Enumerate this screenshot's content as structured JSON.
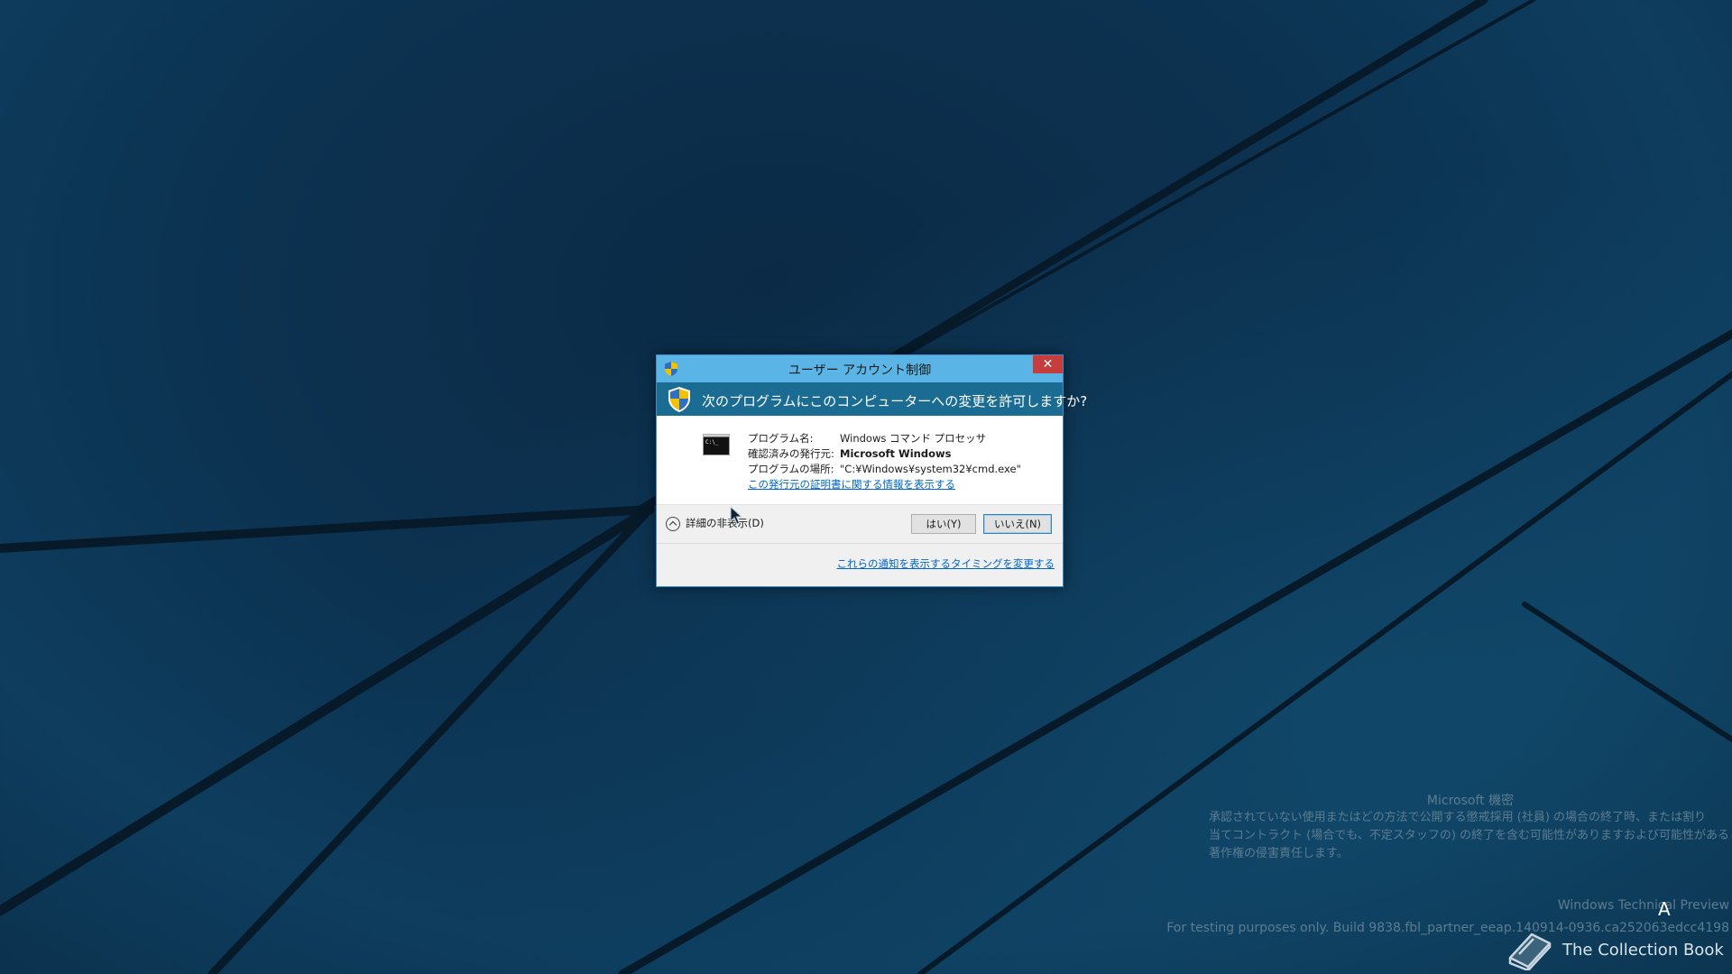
{
  "dialog": {
    "title": "ユーザー アカウント制御",
    "close_glyph": "✕",
    "question": "次のプログラムにこのコンピューターへの変更を許可しますか?",
    "program_icon": "cmd-icon",
    "program_icon_text": "C:\\_",
    "fields": [
      {
        "label": "プログラム名:",
        "value": "Windows コマンド プロセッサ",
        "bold": false
      },
      {
        "label": "確認済みの発行元:",
        "value": "Microsoft Windows",
        "bold": true
      },
      {
        "label": "プログラムの場所:",
        "value": "\"C:¥Windows¥system32¥cmd.exe\"",
        "bold": false
      }
    ],
    "cert_link": "この発行元の証明書に関する情報を表示する",
    "details_toggle": "詳細の非表示(D)",
    "yes_button": "はい(Y)",
    "no_button": "いいえ(N)",
    "timing_link": "これらの通知を表示するタイミングを変更する",
    "colors": {
      "titlebar": "#5ab4e6",
      "header": "#1b6c93",
      "close": "#c73d3d",
      "link": "#0066cc"
    }
  },
  "watermark": {
    "confidential_title": "Microsoft 機密",
    "confidential_lines": [
      "承認されていない使用またはどの方法で公開する懲戒採用 (社員) の場合の終了時、または割り",
      "当てコントラクト (場合でも、不定スタッフの) の終了を含む可能性がありますおよび可能性があると、",
      "著作権の侵害責任します。"
    ],
    "preview_label": "Windows Technical Preview",
    "build_label": "For testing purposes only. Build 9838.fbl_partner_eeap.140914-0936.ca252063edcc4198"
  },
  "badge": {
    "label": "The Collection Book",
    "icon": "book-icon"
  },
  "caret_glyph": "A"
}
